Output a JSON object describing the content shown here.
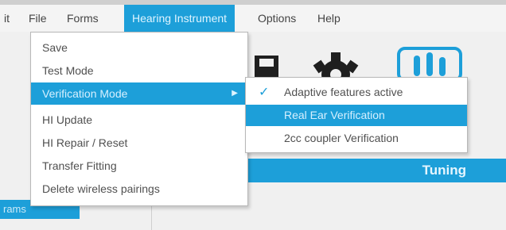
{
  "menubar": {
    "items": [
      {
        "label": "it"
      },
      {
        "label": "File"
      },
      {
        "label": "Forms"
      },
      {
        "label": "Hearing Instrument"
      },
      {
        "label": "Options"
      },
      {
        "label": "Help"
      }
    ]
  },
  "hi_menu": {
    "items": [
      {
        "label": "Save"
      },
      {
        "label": "Test Mode"
      },
      {
        "label": "Verification Mode"
      },
      {
        "label": "HI Update"
      },
      {
        "label": "HI Repair / Reset"
      },
      {
        "label": "Transfer Fitting"
      },
      {
        "label": "Delete wireless pairings"
      }
    ],
    "highlighted": "Verification Mode",
    "submenu_arrow": "▶"
  },
  "verification_submenu": {
    "items": [
      {
        "label": "Adaptive features active",
        "checked": true,
        "check_glyph": "✓"
      },
      {
        "label": "Real Ear Verification"
      },
      {
        "label": "2cc coupler Verification"
      }
    ],
    "highlighted": "Real Ear Verification"
  },
  "toolbar_icons": [
    "save-icon",
    "gear-icon",
    "tuning-icon"
  ],
  "tabs": {
    "tuning_label": "Tuning",
    "programs_label": "rams"
  },
  "colors": {
    "accent": "#1d9fd9",
    "menu_bg": "#ffffff",
    "menubar_bg": "#f4f4f4"
  }
}
